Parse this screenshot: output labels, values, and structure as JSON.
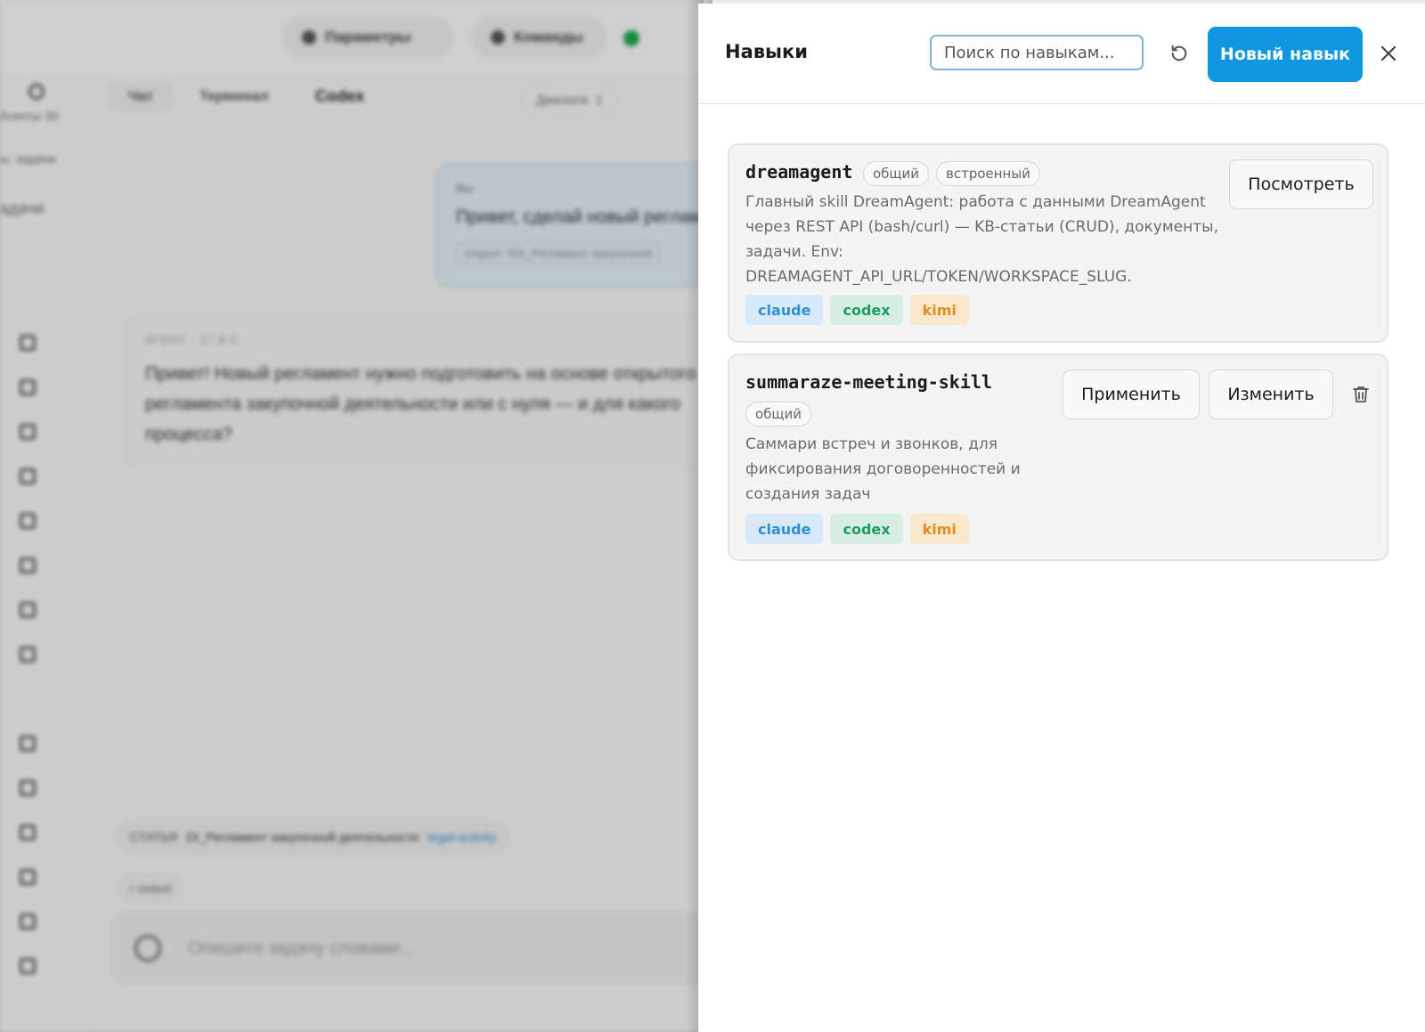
{
  "background_app": {
    "topbar": {
      "params_label": "Параметры",
      "commands_label": "Команды"
    },
    "rail": {
      "label_agents": "Агенты",
      "label_agents_count": "30",
      "label_tasks_hint": "ы, задачи",
      "label_tasks": "адачи"
    },
    "tabs": [
      "Чат",
      "Терминал",
      "Codex"
    ],
    "dialogs_label": "Диалоги",
    "dialogs_count": "1",
    "user_message": {
      "who": "Вы",
      "text": "Привет, сделай новый регламент",
      "chip": "открыт: #DI_Регламент закупочной"
    },
    "agent_message": {
      "who": "АГЕНТ · 17.8 С",
      "text": "Привет! Новый регламент нужно подготовить на основе открытого регламента закупочной деятельности или с нуля — и для какого процесса?"
    },
    "article": {
      "prefix": "СТАТЬЯ",
      "title": "DI_Регламент закупочной деятельности",
      "link": "legal-activity"
    },
    "new_chip": "+ новые",
    "composer_placeholder": "Опишите задачу словами..."
  },
  "drawer": {
    "title": "Навыки",
    "search_placeholder": "Поиск по навыкам...",
    "new_skill_label": "Новый навык",
    "refresh_icon": "refresh-icon",
    "close_icon": "close-icon"
  },
  "skills": [
    {
      "name": "dreamagent",
      "badges": [
        "общий",
        "встроенный"
      ],
      "description": "Главный skill DreamAgent: работа с данными DreamAgent через REST API (bash/curl) — KB-статьи (CRUD), документы, задачи. Env: DREAMAGENT_API_URL/TOKEN/WORKSPACE_SLUG.",
      "tags": [
        "claude",
        "codex",
        "kimi"
      ],
      "view_label": "Посмотреть"
    },
    {
      "name": "summaraze-meeting-skill",
      "badges": [
        "общий"
      ],
      "description": "Саммари встреч и звонков, для фиксирования договоренностей и создания задач",
      "tags": [
        "claude",
        "codex",
        "kimi"
      ],
      "apply_label": "Применить",
      "edit_label": "Изменить",
      "delete_icon": "trash-icon"
    }
  ],
  "colors": {
    "accent": "#0f98e0",
    "tag_claude": "#2f8fd0",
    "tag_codex": "#1e9c5f",
    "tag_kimi": "#de8f1c"
  }
}
